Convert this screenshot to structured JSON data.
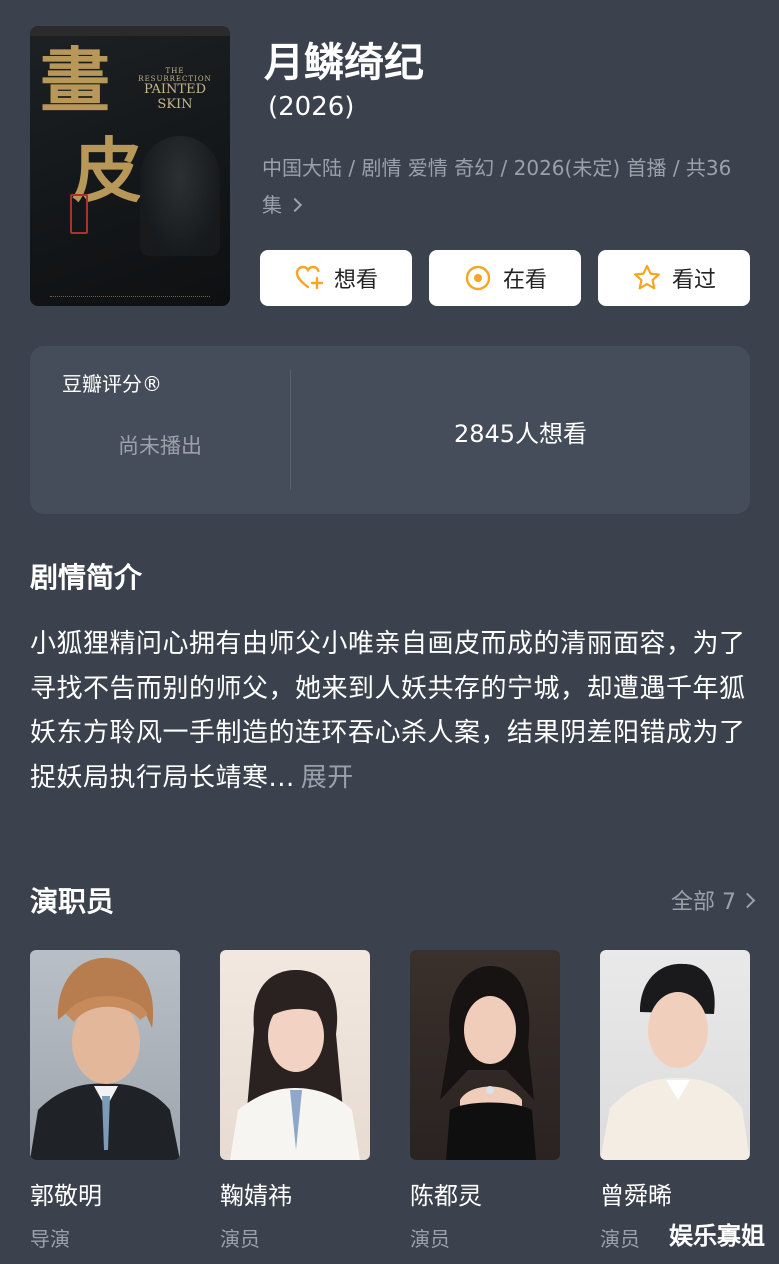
{
  "poster": {
    "title_chars": [
      "畫",
      "皮"
    ],
    "english_title_small": "THE RESURRECTION",
    "english_title": "PAINTED SKIN"
  },
  "drama": {
    "title": "月鳞绮纪",
    "year": "(2026)",
    "meta": "中国大陆 / 剧情 爱情 奇幻 / 2026(未定) 首播 / 共36集"
  },
  "actions": [
    {
      "label": "想看",
      "icon": "heart-plus-icon"
    },
    {
      "label": "在看",
      "icon": "target-icon"
    },
    {
      "label": "看过",
      "icon": "star-outline-icon"
    }
  ],
  "rating": {
    "label": "豆瓣评分®",
    "status": "尚未播出",
    "wish_count": "2845人想看"
  },
  "synopsis": {
    "heading": "剧情简介",
    "text": "小狐狸精问心拥有由师父小唯亲自画皮而成的清丽面容，为了寻找不告而别的师父，她来到人妖共存的宁城，却遭遇千年狐妖东方聆风一手制造的连环吞心杀人案，结果阴差阳错成为了捉妖局执行局长靖寒...",
    "expand_label": "展开"
  },
  "cast": {
    "heading": "演职员",
    "all_label": "全部 7",
    "members": [
      {
        "name": "郭敬明",
        "role": "导演"
      },
      {
        "name": "鞠婧祎",
        "role": "演员"
      },
      {
        "name": "陈都灵",
        "role": "演员"
      },
      {
        "name": "曾舜晞",
        "role": "演员"
      }
    ]
  },
  "watermark": "娱乐寡姐",
  "colors": {
    "background": "#3b424e",
    "card": "#464d5a",
    "accent": "#f5a623",
    "muted_text": "#9aa1ab"
  }
}
